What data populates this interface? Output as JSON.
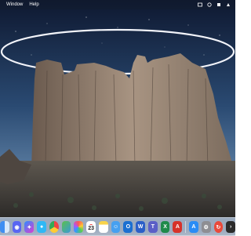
{
  "menubar": {
    "items": [
      "Window",
      "Help"
    ]
  },
  "dock": {
    "calendar_day": "23",
    "icons": [
      {
        "name": "finder-icon",
        "color": "#3f8ef2"
      },
      {
        "name": "discord-icon",
        "color": "#5865f2"
      },
      {
        "name": "messenger-icon",
        "color": "#a23cf0"
      },
      {
        "name": "messages-icon",
        "color": "#2fb8f5"
      },
      {
        "name": "chrome-icon",
        "color": "#e8e8e8"
      },
      {
        "name": "maps-icon",
        "color": "#5bbf4b"
      },
      {
        "name": "photos-icon",
        "color": "#f4f4f4"
      },
      {
        "name": "calendar-icon",
        "color": "#ffffff"
      },
      {
        "name": "notes-icon",
        "color": "#f8d34a"
      },
      {
        "name": "finder-alt-icon",
        "color": "#46a0f0"
      },
      {
        "name": "outlook-icon",
        "color": "#1b6fd1"
      },
      {
        "name": "word-icon",
        "color": "#2b5fc8"
      },
      {
        "name": "teams-icon",
        "color": "#5b5fc7"
      },
      {
        "name": "excel-icon",
        "color": "#1f8a4b"
      },
      {
        "name": "acrobat-icon",
        "color": "#d6322a"
      },
      {
        "name": "app-store-icon",
        "color": "#2a8cf5"
      },
      {
        "name": "system-settings-icon",
        "color": "#8e8e93"
      },
      {
        "name": "transmit-icon",
        "color": "#e9493a"
      },
      {
        "name": "terminal-icon",
        "color": "#2b2b2b"
      }
    ]
  }
}
